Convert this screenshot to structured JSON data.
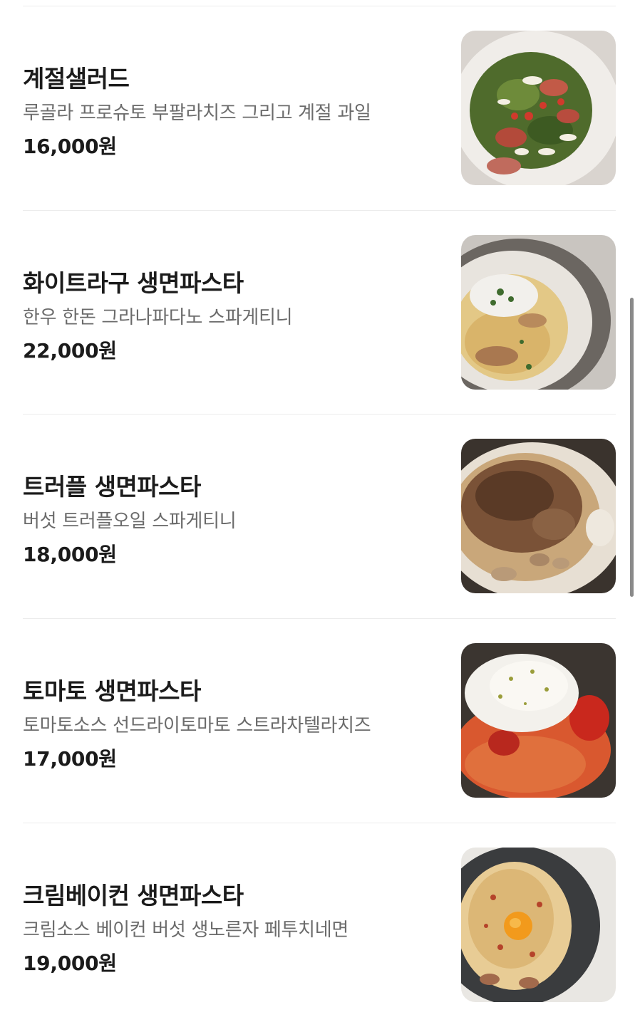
{
  "menu": {
    "items": [
      {
        "name": "계절샐러드",
        "description": "루골라 프로슈토 부팔라치즈 그리고 계절 과일",
        "price": "16,000원",
        "photo_alt": "salad-photo"
      },
      {
        "name": "화이트라구 생면파스타",
        "description": "한우 한돈 그라나파다노 스파게티니",
        "price": "22,000원",
        "photo_alt": "white-ragu-pasta-photo"
      },
      {
        "name": "트러플 생면파스타",
        "description": "버섯 트러플오일 스파게티니",
        "price": "18,000원",
        "photo_alt": "truffle-pasta-photo"
      },
      {
        "name": "토마토 생면파스타",
        "description": "토마토소스 선드라이토마토 스트라차텔라치즈",
        "price": "17,000원",
        "photo_alt": "tomato-pasta-photo"
      },
      {
        "name": "크림베이컨 생면파스타",
        "description": "크림소스 베이컨 버섯 생노른자 페투치네면",
        "price": "19,000원",
        "photo_alt": "cream-bacon-pasta-photo"
      }
    ]
  },
  "colors": {
    "text_primary": "#1b1b1b",
    "text_secondary": "#6b6b6b",
    "divider": "#ececec",
    "scrollbar": "#8a8a8a"
  }
}
